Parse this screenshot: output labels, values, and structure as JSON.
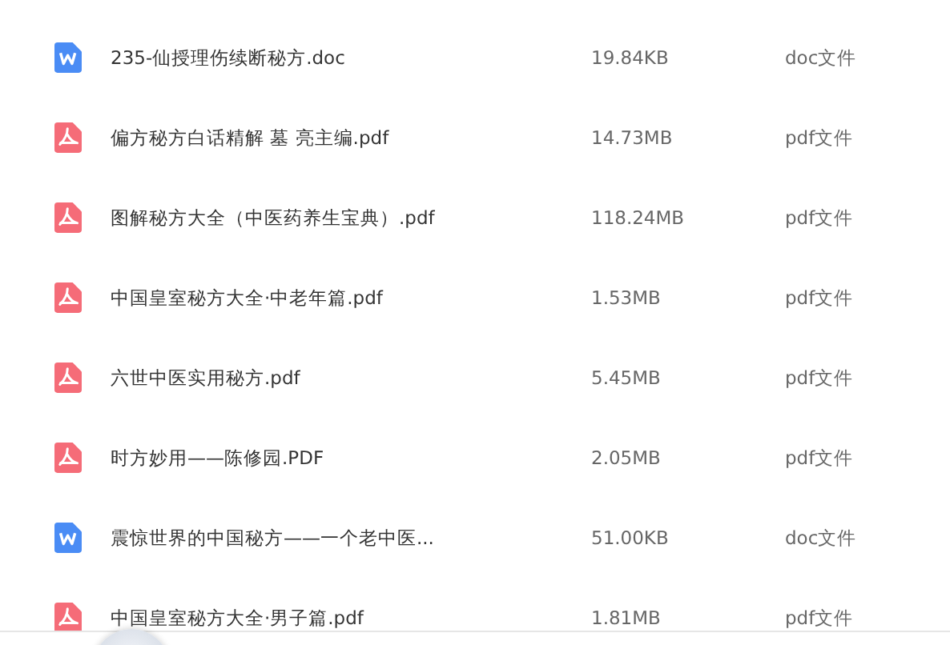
{
  "files": [
    {
      "kind": "doc",
      "name": "235-仙授理伤续断秘方.doc",
      "size": "19.84KB",
      "type": "doc文件"
    },
    {
      "kind": "pdf",
      "name": "偏方秘方白话精解 墓 亮主编.pdf",
      "size": "14.73MB",
      "type": "pdf文件"
    },
    {
      "kind": "pdf",
      "name": "图解秘方大全（中医药养生宝典）.pdf",
      "size": "118.24MB",
      "type": "pdf文件"
    },
    {
      "kind": "pdf",
      "name": "中国皇室秘方大全·中老年篇.pdf",
      "size": "1.53MB",
      "type": "pdf文件"
    },
    {
      "kind": "pdf",
      "name": "六世中医实用秘方.pdf",
      "size": "5.45MB",
      "type": "pdf文件"
    },
    {
      "kind": "pdf",
      "name": "时方妙用——陈修园.PDF",
      "size": "2.05MB",
      "type": "pdf文件"
    },
    {
      "kind": "doc",
      "name": "震惊世界的中国秘方——一个老中医...",
      "size": "51.00KB",
      "type": "doc文件"
    },
    {
      "kind": "pdf",
      "name": "中国皇室秘方大全·男子篇.pdf",
      "size": "1.81MB",
      "type": "pdf文件"
    }
  ]
}
